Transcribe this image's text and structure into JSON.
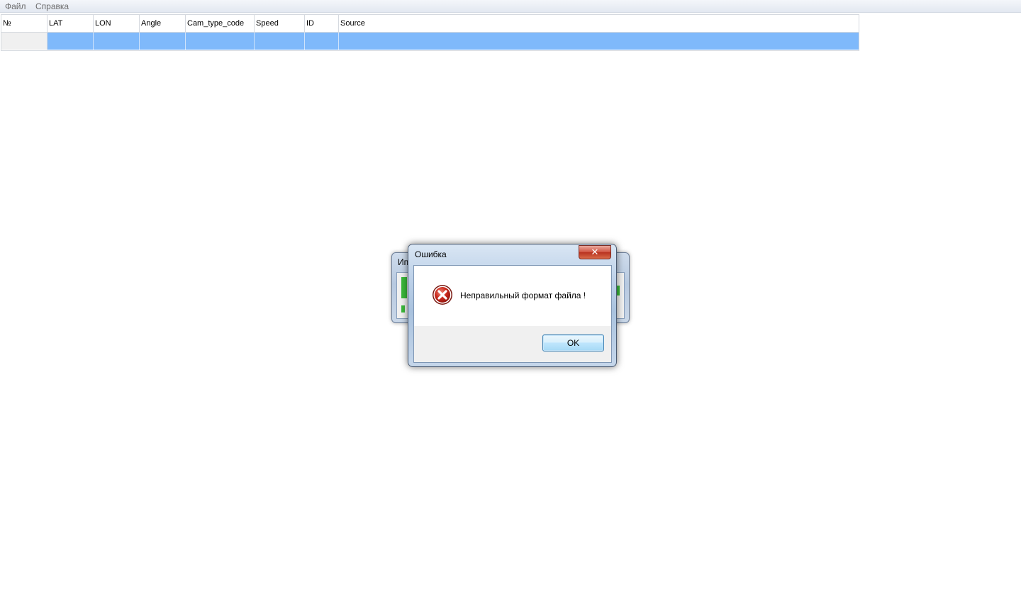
{
  "menu": {
    "items": [
      {
        "label": "Файл"
      },
      {
        "label": "Справка"
      }
    ]
  },
  "grid": {
    "columns": [
      {
        "label": "№"
      },
      {
        "label": "LAT"
      },
      {
        "label": "LON"
      },
      {
        "label": "Angle"
      },
      {
        "label": "Cam_type_code"
      },
      {
        "label": "Speed"
      },
      {
        "label": "ID"
      },
      {
        "label": "Source"
      }
    ],
    "rows": [
      {
        "cells": [
          "",
          "",
          "",
          "",
          "",
          "",
          ""
        ]
      }
    ],
    "selected_row_color": "#7fb9fb"
  },
  "background_dialog": {
    "title": "Ип"
  },
  "error_dialog": {
    "title": "Ошибка",
    "close_label": "✕",
    "message": "Неправильный формат файла !",
    "ok_label": "OK",
    "icon": "error-icon"
  }
}
